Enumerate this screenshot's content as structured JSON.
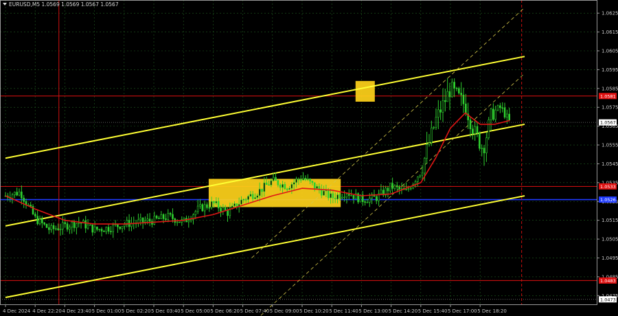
{
  "header": {
    "symbol_line": "EURUSD,M5  1.0569 1.0569 1.0567 1.0567"
  },
  "chart_data": {
    "type": "candlestick",
    "symbol": "EURUSD",
    "timeframe": "M5",
    "ohlc_header": {
      "open": "1.0569",
      "high": "1.0569",
      "low": "1.0567",
      "close": "1.0567"
    },
    "ylim": [
      1.047,
      1.0632
    ],
    "y_ticks": [
      "1.0625",
      "1.0615",
      "1.0605",
      "1.0595",
      "1.0585",
      "1.0575",
      "1.0565",
      "1.0555",
      "1.0545",
      "1.0535",
      "1.0525",
      "1.0515",
      "1.0505",
      "1.0495",
      "1.0485",
      "1.0475"
    ],
    "x_ticks": [
      "4 Dec 2024",
      "4 Dec 22:20",
      "4 Dec 23:40",
      "5 Dec 01:00",
      "5 Dec 02:20",
      "5 Dec 03:40",
      "5 Dec 05:00",
      "5 Dec 06:20",
      "5 Dec 07:40",
      "5 Dec 09:00",
      "5 Dec 10:20",
      "5 Dec 11:40",
      "5 Dec 13:00",
      "5 Dec 14:20",
      "5 Dec 15:40",
      "5 Dec 17:00",
      "5 Dec 18:20"
    ],
    "price_series": [
      {
        "t": 0,
        "p": 1.0528
      },
      {
        "t": 0.5,
        "p": 1.053
      },
      {
        "t": 1,
        "p": 1.0516
      },
      {
        "t": 1.5,
        "p": 1.051
      },
      {
        "t": 2,
        "p": 1.0512
      },
      {
        "t": 2.5,
        "p": 1.0514
      },
      {
        "t": 3,
        "p": 1.051
      },
      {
        "t": 3.5,
        "p": 1.0511
      },
      {
        "t": 4,
        "p": 1.0513
      },
      {
        "t": 4.5,
        "p": 1.0514
      },
      {
        "t": 5,
        "p": 1.0515
      },
      {
        "t": 5.5,
        "p": 1.0517
      },
      {
        "t": 6,
        "p": 1.0514
      },
      {
        "t": 6.5,
        "p": 1.0521
      },
      {
        "t": 7,
        "p": 1.0524
      },
      {
        "t": 7.5,
        "p": 1.0519
      },
      {
        "t": 8,
        "p": 1.0526
      },
      {
        "t": 8.5,
        "p": 1.053
      },
      {
        "t": 9,
        "p": 1.0536
      },
      {
        "t": 9.5,
        "p": 1.0533
      },
      {
        "t": 10,
        "p": 1.0538
      },
      {
        "t": 10.5,
        "p": 1.0532
      },
      {
        "t": 11,
        "p": 1.0527
      },
      {
        "t": 11.5,
        "p": 1.053
      },
      {
        "t": 12,
        "p": 1.0526
      },
      {
        "t": 12.5,
        "p": 1.0527
      },
      {
        "t": 13,
        "p": 1.0533
      },
      {
        "t": 13.5,
        "p": 1.053
      },
      {
        "t": 14,
        "p": 1.0541
      },
      {
        "t": 14.5,
        "p": 1.0568
      },
      {
        "t": 15,
        "p": 1.0585
      },
      {
        "t": 15.5,
        "p": 1.0576
      },
      {
        "t": 15.8,
        "p": 1.0562
      },
      {
        "t": 16.1,
        "p": 1.0553
      },
      {
        "t": 16.4,
        "p": 1.0572
      },
      {
        "t": 16.7,
        "p": 1.0575
      },
      {
        "t": 17,
        "p": 1.0567
      }
    ],
    "moving_average": [
      {
        "t": 0,
        "p": 1.0528
      },
      {
        "t": 1,
        "p": 1.0521
      },
      {
        "t": 2,
        "p": 1.0515
      },
      {
        "t": 3,
        "p": 1.0513
      },
      {
        "t": 4,
        "p": 1.0513
      },
      {
        "t": 5,
        "p": 1.0514
      },
      {
        "t": 6,
        "p": 1.0515
      },
      {
        "t": 7,
        "p": 1.0518
      },
      {
        "t": 8,
        "p": 1.0523
      },
      {
        "t": 9,
        "p": 1.0528
      },
      {
        "t": 10,
        "p": 1.0532
      },
      {
        "t": 11,
        "p": 1.0531
      },
      {
        "t": 12,
        "p": 1.0528
      },
      {
        "t": 13,
        "p": 1.0529
      },
      {
        "t": 14,
        "p": 1.0535
      },
      {
        "t": 14.5,
        "p": 1.0548
      },
      {
        "t": 15,
        "p": 1.0564
      },
      {
        "t": 15.5,
        "p": 1.0572
      },
      {
        "t": 16,
        "p": 1.0566
      },
      {
        "t": 16.5,
        "p": 1.0566
      },
      {
        "t": 17,
        "p": 1.0568
      }
    ],
    "horizontal_levels": [
      {
        "price": 1.0581,
        "label": "1.0581",
        "color": "#e01010"
      },
      {
        "price": 1.0533,
        "label": "1.0533",
        "color": "#e01010"
      },
      {
        "price": 1.0526,
        "label": "1.0526",
        "color": "#1f3bff"
      },
      {
        "price": 1.0483,
        "label": "1.0483",
        "color": "#e01010"
      },
      {
        "price": 1.0567,
        "label": "1.0567",
        "color": "#808080"
      },
      {
        "price": 1.0473,
        "label": "1.0473",
        "color": "#808080"
      }
    ],
    "trend_lines": [
      {
        "from": {
          "t": 0,
          "p": 1.0548
        },
        "to": {
          "t": 17.5,
          "p": 1.0602
        }
      },
      {
        "from": {
          "t": 0,
          "p": 1.0512
        },
        "to": {
          "t": 17.5,
          "p": 1.0566
        }
      },
      {
        "from": {
          "t": 0,
          "p": 1.0474
        },
        "to": {
          "t": 17.5,
          "p": 1.0528
        }
      }
    ],
    "channel_lines": [
      {
        "from": {
          "t": 8.3,
          "p": 1.0495
        },
        "to": {
          "t": 17.5,
          "p": 1.0628
        }
      },
      {
        "from": {
          "t": 8.3,
          "p": 1.046
        },
        "to": {
          "t": 17.5,
          "p": 1.0593
        }
      }
    ],
    "highlight_boxes": [
      {
        "t_start": 6.85,
        "t_end": 11.3,
        "p_high": 1.0537,
        "p_low": 1.0522
      },
      {
        "t_start": 11.8,
        "t_end": 12.45,
        "p_high": 1.0589,
        "p_low": 1.0578
      }
    ],
    "vertical_lines": [
      {
        "t": 1.8,
        "color": "#d01010",
        "style": "solid"
      },
      {
        "t": 17.4,
        "color": "#d01010",
        "style": "dashed"
      }
    ],
    "colors": {
      "background": "#000000",
      "candles": "#2fd02f",
      "moving_average": "#e01515",
      "trend_lines": "#ffff33",
      "highlight": "#ffd21a",
      "grid": "#1f5c1f"
    },
    "grid": true
  }
}
